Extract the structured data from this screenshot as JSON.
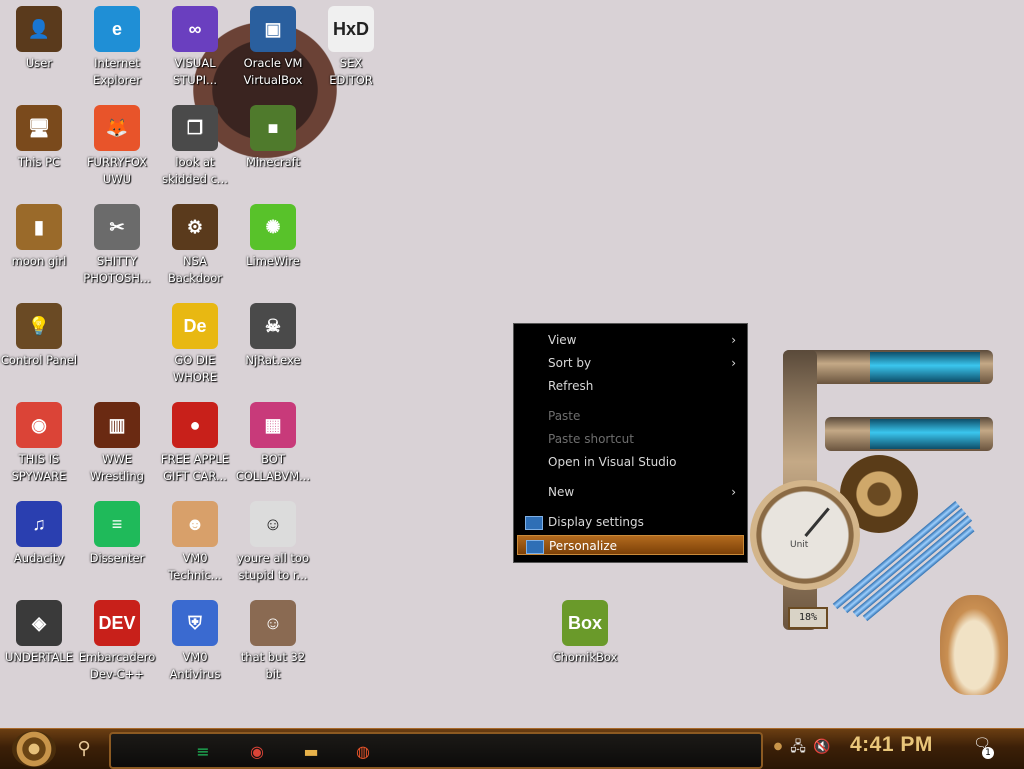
{
  "desktop_icons": [
    {
      "label": "User",
      "glyph": "👤",
      "color": "#5a3a1c"
    },
    {
      "label": "Internet\nExplorer",
      "glyph": "e",
      "color": "#1f8fd6"
    },
    {
      "label": "VISUAL\nSTUPI...",
      "glyph": "∞",
      "color": "#6a3fbf"
    },
    {
      "label": "Oracle VM\nVirtualBox",
      "glyph": "▣",
      "color": "#2a5f9e"
    },
    {
      "label": "SEX\nEDITOR",
      "glyph": "HxD",
      "color": "#f0f0f0"
    },
    {
      "label": "This PC",
      "glyph": "🖥",
      "color": "#7a4a1c"
    },
    {
      "label": "FURRYFOX\nUWU",
      "glyph": "🦊",
      "color": "#e8542a"
    },
    {
      "label": "look at\nskidded c...",
      "glyph": "❐",
      "color": "#4a4a4a"
    },
    {
      "label": "Minecraft",
      "glyph": "■",
      "color": "#4f7a2c"
    },
    {
      "label": "moon girl",
      "glyph": "▮",
      "color": "#9a6a2a"
    },
    {
      "label": "SHITTY\nPHOTOSH...",
      "glyph": "✂",
      "color": "#6b6b6b"
    },
    {
      "label": "NSA\nBackdoor",
      "glyph": "⚙",
      "color": "#5a3a1c"
    },
    {
      "label": "LimeWire",
      "glyph": "✺",
      "color": "#58c22a"
    },
    {
      "label": "Control Panel",
      "glyph": "💡",
      "color": "#6a4a24"
    },
    {
      "label": "GO DIE\nWHORE",
      "glyph": "De",
      "color": "#e8b812"
    },
    {
      "label": "NjRat.exe",
      "glyph": "☠",
      "color": "#4a4a4a"
    },
    {
      "label": "THIS IS\nSPYWARE",
      "glyph": "◉",
      "color": "#db4437"
    },
    {
      "label": "WWE\nWrestling",
      "glyph": "▥",
      "color": "#6a2a12"
    },
    {
      "label": "FREE APPLE\nGIFT CAR...",
      "glyph": "●",
      "color": "#c8201a"
    },
    {
      "label": "BOT\nCOLLABVM...",
      "glyph": "▦",
      "color": "#c83a7a"
    },
    {
      "label": "Audacity",
      "glyph": "♫",
      "color": "#2a3fb0"
    },
    {
      "label": "Dissenter",
      "glyph": "≡",
      "color": "#1fba5a"
    },
    {
      "label": "VM0\nTechnic...",
      "glyph": "☻",
      "color": "#d8a06a"
    },
    {
      "label": "youre all too\nstupid to r...",
      "glyph": "☺",
      "color": "#dcdcdc"
    },
    {
      "label": "UNDERTALE",
      "glyph": "◈",
      "color": "#3a3a3a"
    },
    {
      "label": "Embarcadero\nDev-C++",
      "glyph": "DEV",
      "color": "#c8201a"
    },
    {
      "label": "VM0\nAntivirus",
      "glyph": "⛨",
      "color": "#3a6ad0"
    },
    {
      "label": "that but 32\nbit",
      "glyph": "☺",
      "color": "#8a6a52"
    },
    {
      "label": "ChomikBox",
      "glyph": "Box",
      "color": "#6a9a2a"
    }
  ],
  "context_menu": {
    "items": [
      {
        "label": "View",
        "state": "normal",
        "submenu": true
      },
      {
        "label": "Sort by",
        "state": "normal",
        "submenu": true
      },
      {
        "label": "Refresh",
        "state": "normal",
        "submenu": false
      },
      {
        "label": "Paste",
        "state": "disabled",
        "submenu": false
      },
      {
        "label": "Paste shortcut",
        "state": "disabled",
        "submenu": false
      },
      {
        "label": "Open in Visual Studio",
        "state": "normal",
        "submenu": false
      },
      {
        "label": "New",
        "state": "normal",
        "submenu": true
      },
      {
        "label": "Display settings",
        "state": "normal",
        "submenu": false,
        "icon": "display-icon"
      },
      {
        "label": "Personalize",
        "state": "highlighted",
        "submenu": false,
        "icon": "personalize-icon"
      }
    ]
  },
  "gauge": {
    "percent": "18%",
    "unit": "Unit"
  },
  "taskbar": {
    "start_icon": "start-orb-icon",
    "search_glyph": "⚲",
    "pinned": [
      {
        "name": "dissenter-taskbar-icon",
        "glyph": "≡",
        "color": "#1fba5a"
      },
      {
        "name": "chrome-taskbar-icon",
        "glyph": "◉",
        "color": "#db4437"
      },
      {
        "name": "file-explorer-taskbar-icon",
        "glyph": "▬",
        "color": "#e8b24a"
      },
      {
        "name": "firefox-taskbar-icon",
        "glyph": "◍",
        "color": "#e8542a"
      }
    ],
    "clock": "4:41 PM",
    "notification_count": "1"
  }
}
